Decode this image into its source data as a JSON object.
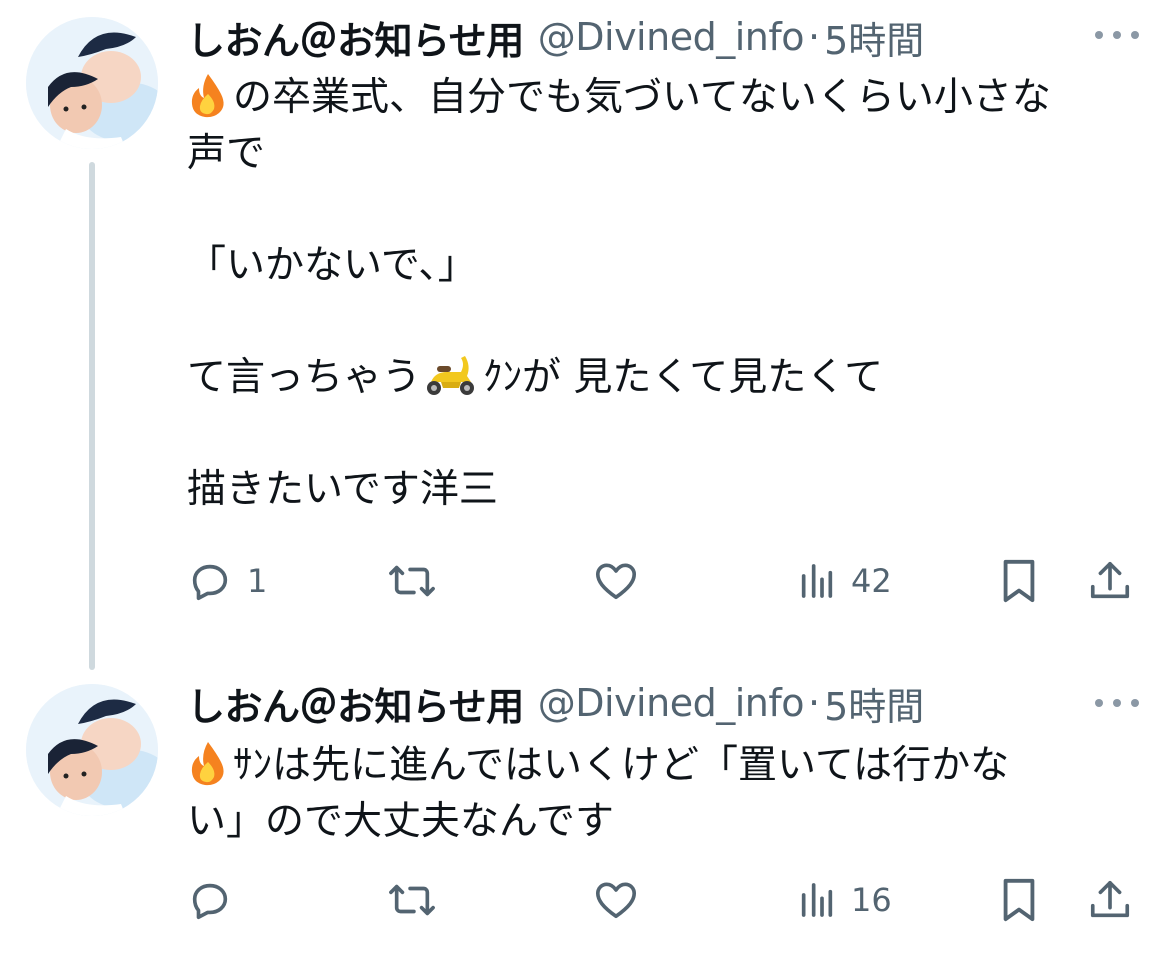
{
  "colors": {
    "text": "#0f1419",
    "secondary": "#536471",
    "thread_line": "#cfd9de",
    "fire": "#f5821f",
    "scooter": "#f2c81f"
  },
  "tweets": [
    {
      "author": {
        "display_name": "しおん＠お知らせ用",
        "handle": "@Divined_info",
        "separator": "·",
        "time": "5時間"
      },
      "body": {
        "line1": "の卒業式、自分でも気づいてないくらい小さな",
        "line2": "声で",
        "line3": "「いかないで、」",
        "line4_pre": "て言っちゃう",
        "line4_post": "ｸﾝが 見たくて見たくて",
        "line5": "描きたいです洋三",
        "emojis": [
          "fire-emoji",
          "scooter-emoji"
        ]
      },
      "actions": {
        "reply_count": "1",
        "retweet_count": "",
        "like_count": "",
        "views_count": "42"
      }
    },
    {
      "author": {
        "display_name": "しおん＠お知らせ用",
        "handle": "@Divined_info",
        "separator": "·",
        "time": "5時間"
      },
      "body": {
        "line1": "ｻﾝは先に進んではいくけど「置いては行かな",
        "line2": "い」ので大丈夫なんです",
        "emojis": [
          "fire-emoji"
        ]
      },
      "actions": {
        "reply_count": "",
        "retweet_count": "",
        "like_count": "",
        "views_count": "16"
      }
    }
  ]
}
